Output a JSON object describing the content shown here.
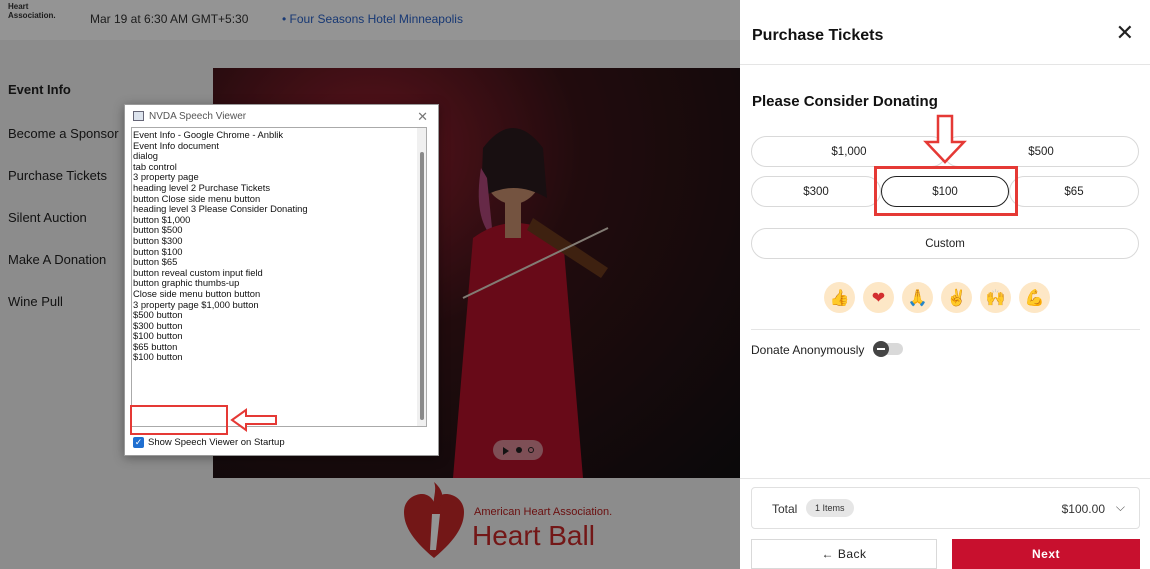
{
  "background": {
    "logo_text": [
      "Heart",
      "Association."
    ],
    "event_date": "Mar 19 at 6:30 AM GMT+5:30",
    "event_venue": "• Four Seasons Hotel Minneapolis",
    "nav": [
      "Event Info",
      "Become a Sponsor",
      "Purchase Tickets",
      "Silent Auction",
      "Make A Donation",
      "Wine Pull"
    ],
    "brand_name": "American Heart Association.",
    "brand_event": "Heart Ball",
    "brand_color": "#c62828"
  },
  "nvda": {
    "title": "NVDA Speech Viewer",
    "lines": [
      "Event Info - Google Chrome - Anblik",
      "Event Info  document",
      "dialog",
      "tab control",
      "3  property page",
      "heading    level 2  Purchase Tickets",
      "button    Close side menu button",
      "heading    level 3  Please Consider Donating",
      "button    $1,000",
      "button    $500",
      "button    $300",
      "button    $100",
      "button    $65",
      "button    reveal custom input field",
      "button    graphic    thumbs-up",
      "Close side menu button  button",
      "3  property page  $1,000  button",
      "$500  button",
      "$300  button",
      "$100  button",
      "$65  button",
      "$100  button"
    ],
    "footer_checkbox": "Show Speech Viewer on Startup",
    "footer_checked": true
  },
  "panel": {
    "title": "Purchase Tickets",
    "donate_heading": "Please Consider Donating",
    "amounts": [
      "$1,000",
      "$500",
      "$300",
      "$100",
      "$65"
    ],
    "selected_amount": "$100",
    "custom_label": "Custom",
    "reactions": [
      "thumbs-up-icon",
      "heart-icon",
      "praying-hands-icon",
      "victory-hand-icon",
      "raised-hands-icon",
      "flexed-biceps-icon"
    ],
    "anonymous_label": "Donate Anonymously",
    "anonymous_on": false,
    "total_label": "Total",
    "total_items": "1 Items",
    "total_amount": "$100.00",
    "back_label": "← Back",
    "next_label": "Next",
    "accent_color": "#c8102e",
    "annotation_color": "#e53935"
  }
}
